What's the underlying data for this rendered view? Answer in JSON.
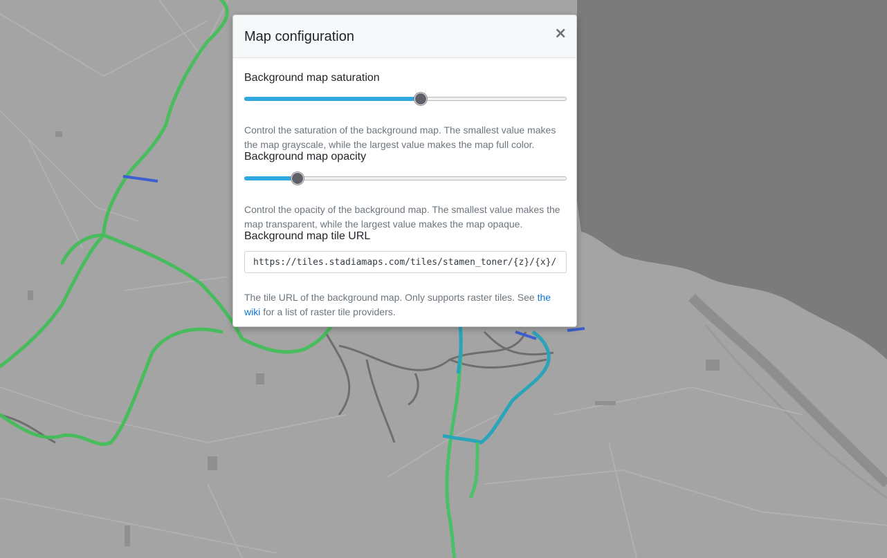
{
  "modal": {
    "title": "Map configuration",
    "close_label": "×",
    "saturation": {
      "label": "Background map saturation",
      "value_fraction": 0.547,
      "help": "Control the saturation of the background map. The smallest value makes the map grayscale, while the largest value makes the map full color."
    },
    "opacity": {
      "label": "Background map opacity",
      "value_fraction": 0.165,
      "help": "Control the opacity of the background map. The smallest value makes the map transparent, while the largest value makes the map opaque."
    },
    "tile_url": {
      "label": "Background map tile URL",
      "value": "https://tiles.stadiamaps.com/tiles/stamen_toner/{z}/{x}/{y}.png",
      "help_before": "The tile URL of the background map. Only supports raster tiles. See ",
      "help_link": "the wiki",
      "help_after": " for a list of raster tile providers."
    }
  },
  "colors": {
    "slider_fill": "#30a7de",
    "slider_thumb": "#5f6068",
    "link": "#0d74d8",
    "map_land": "#a5a5a5",
    "map_water": "#7b7b7b",
    "route_green": "#3fbf55",
    "route_cyan": "#2aa4b8",
    "route_blue": "#3d5fd0"
  }
}
